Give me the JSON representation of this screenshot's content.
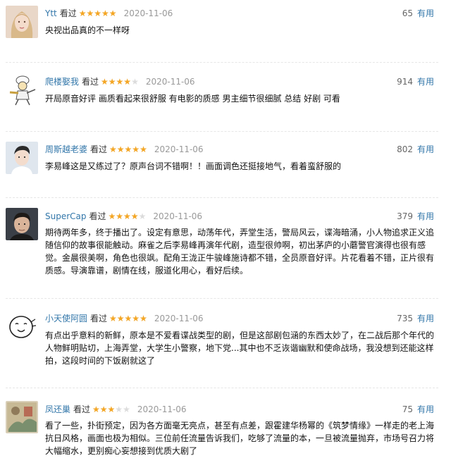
{
  "useful_label": "有用",
  "rated_label": "看过",
  "star_char": "★★★★★",
  "colors": {
    "link": "#3377aa",
    "star": "#f5a623",
    "star_empty": "#dcdcdc",
    "date": "#999999"
  },
  "reviews": [
    {
      "author": "Ytt",
      "rating": 5,
      "date": "2020-11-06",
      "votes": "65",
      "content": "央视出品真的不一样呀",
      "avatar_icon": "user-photo-avatar"
    },
    {
      "author": "爬楼娶我",
      "rating": 4,
      "date": "2020-11-06",
      "votes": "914",
      "content": "开局原音好评 画质看起来很舒服 有电影的质感 男主细节很细腻 总结 好剧 可看",
      "avatar_icon": "cartoon-chef-avatar"
    },
    {
      "author": "周斯越老婆",
      "rating": 5,
      "date": "2020-11-06",
      "votes": "802",
      "content": "李易峰这是又练过了？原声台词不错啊！！画面调色还挺接地气，看着蛮舒服的",
      "avatar_icon": "user-photo-avatar"
    },
    {
      "author": "SuperCap",
      "rating": 4,
      "date": "2020-11-06",
      "votes": "379",
      "content": "期待两年多，终于播出了。设定有意思，动荡年代，弄堂生活，警局风云，谍海暗涌，小人物追求正义追随信仰的故事很能触动。麻雀之后李易峰再演年代剧，造型很帅啊，初出茅庐的小蘑警官演得也很有感觉。金晨很美啊，角色也很飒。配角王泷正牛骏峰施诗都不错，全员原音好评。片花看着不错，正片很有质感。导演靠谱，剧情在线，服道化用心，看好后续。",
      "avatar_icon": "user-photo-avatar"
    },
    {
      "author": "小天使阿圆",
      "rating": 5,
      "date": "2020-11-06",
      "votes": "735",
      "content": "有点出乎意料的新鲜，原本是不爱看谍战类型的剧，但是这部剧包涵的东西太妙了，在二战后那个年代的人物鲜明贴切，上海弄堂，大学生小警察，地下党...其中也不乏诙谐幽默和使命战场，我没想到还能这样拍，这段时间的下饭剧就这了",
      "avatar_icon": "smiley-doodle-avatar"
    },
    {
      "author": "凤还巢",
      "rating": 3,
      "date": "2020-11-06",
      "votes": "75",
      "content": "看了一些，扑街预定，因为各方面毫无亮点，甚至有点差，跟霍建华杨幂的《筑梦情缘》一样走的老上海抗日风格，画面也极为相似。三位前任流量告诉我们，吃够了流量的本，一旦被流量抛弃，市场号召力将大幅缩水，更别痴心妄想接到优质大剧了",
      "avatar_icon": "painting-avatar"
    }
  ]
}
